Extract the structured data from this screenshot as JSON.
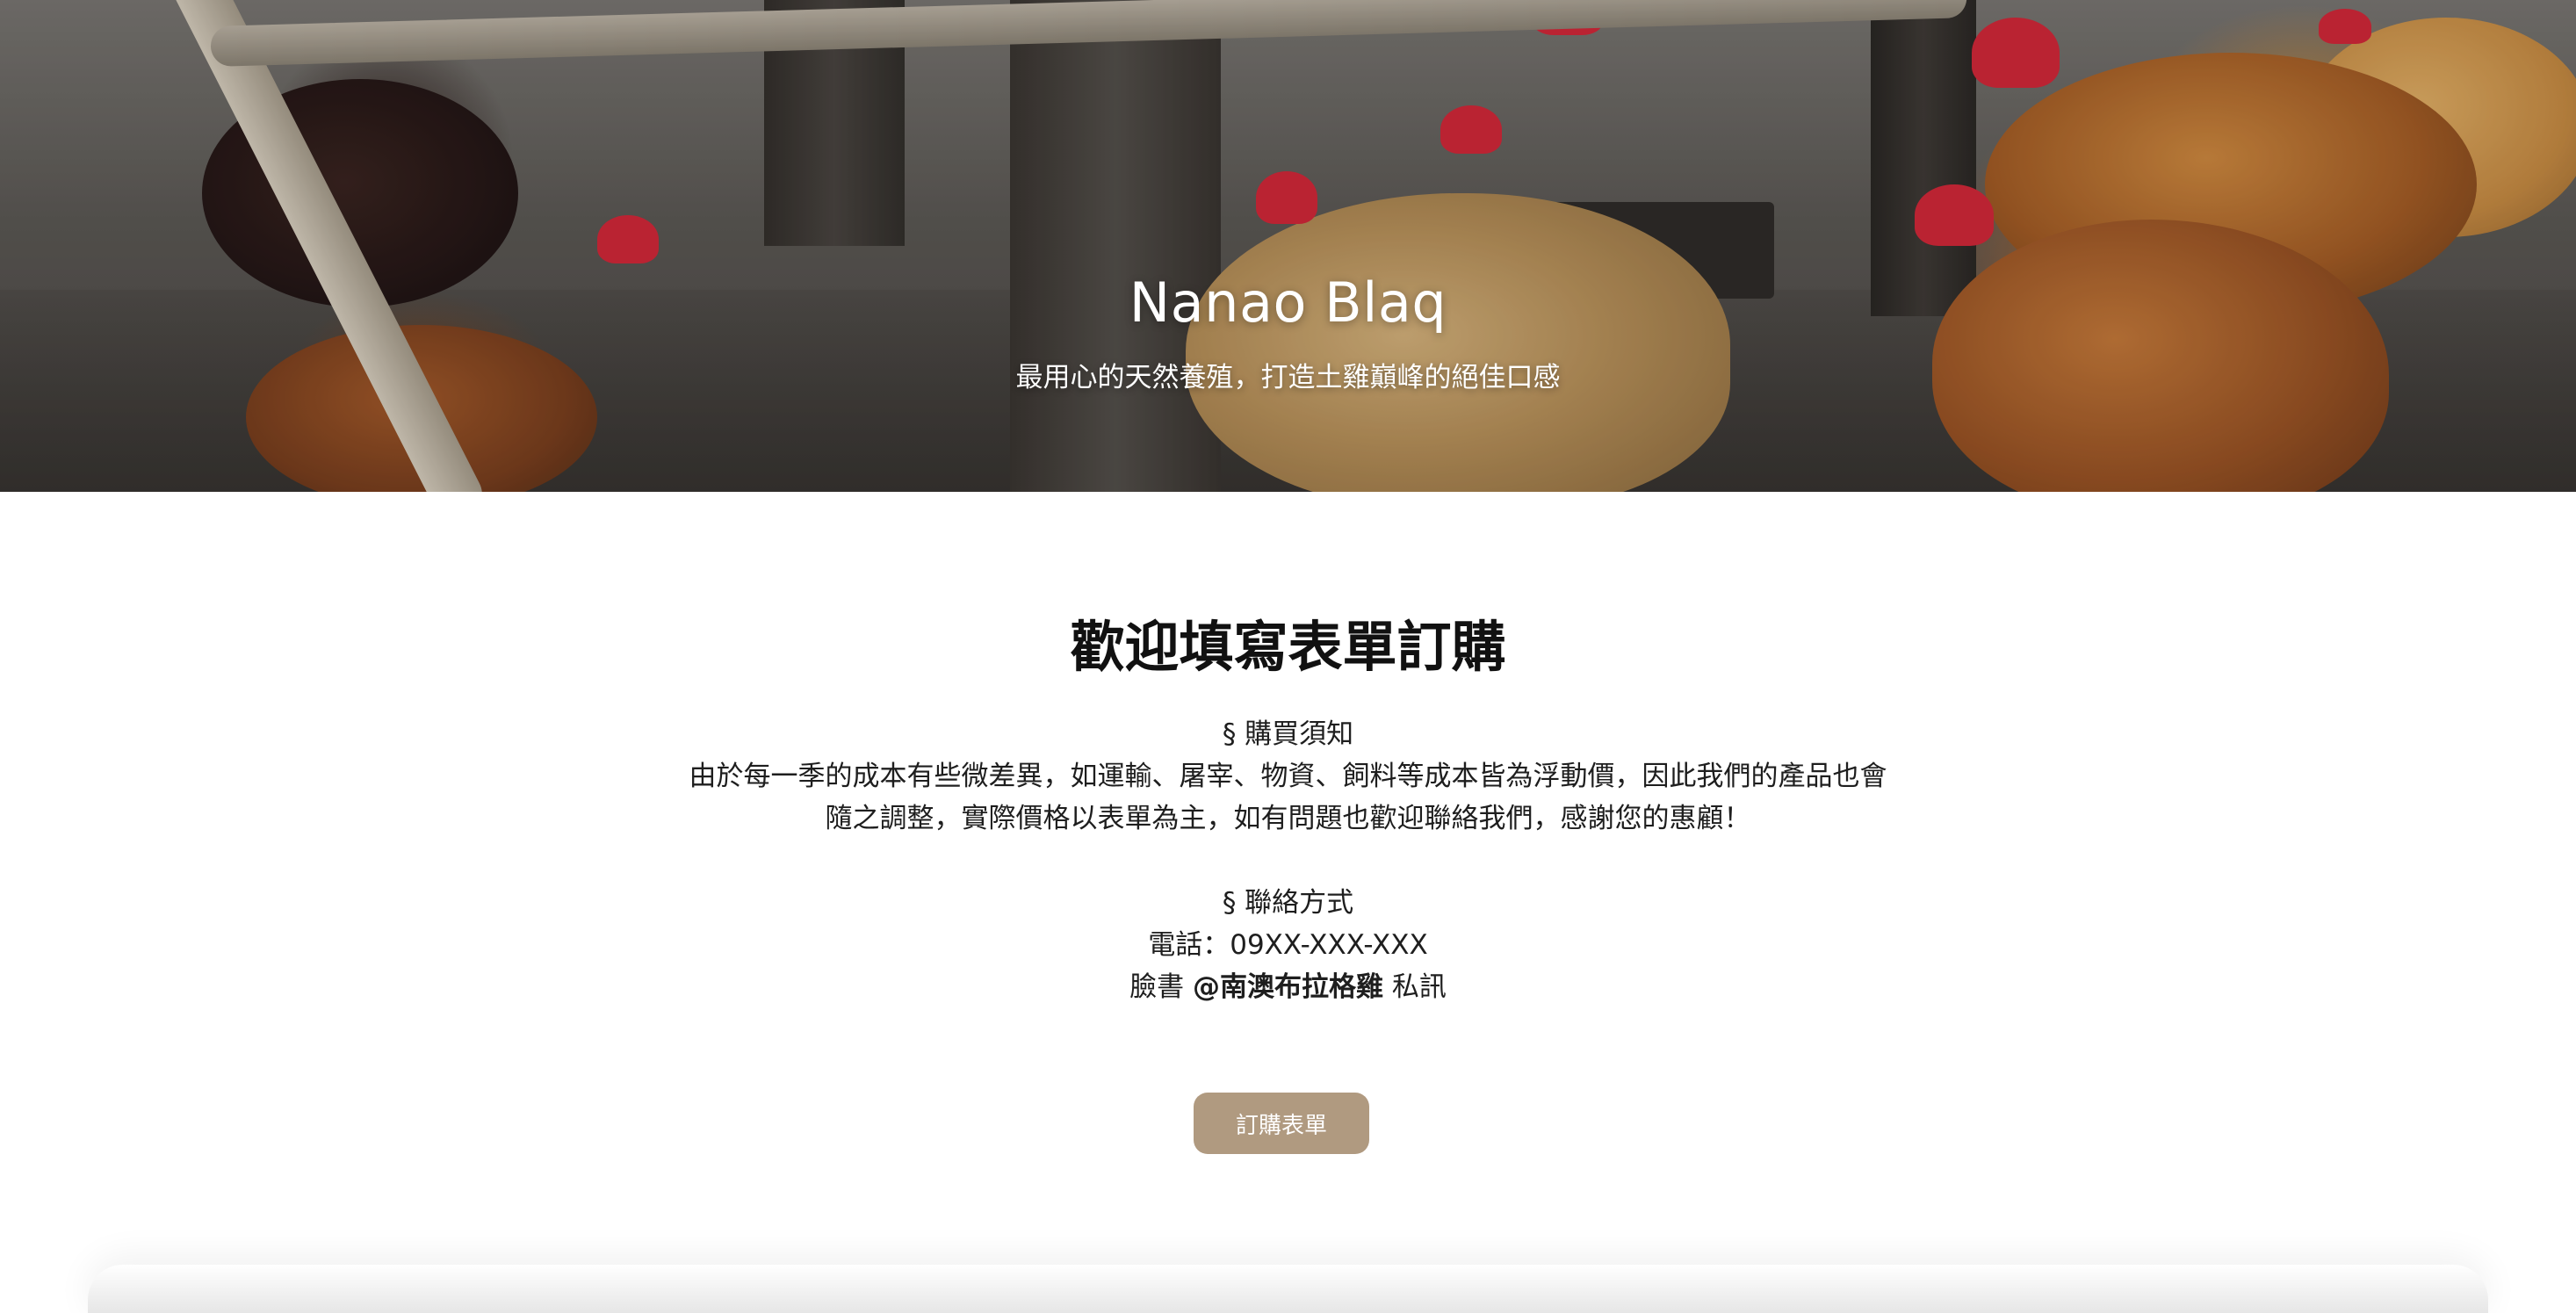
{
  "hero": {
    "title": "Nanao Blaq",
    "subtitle": "最用心的天然養殖，打造土雞巔峰的絕佳口感"
  },
  "main": {
    "heading": "歡迎填寫表單訂購",
    "purchase_notice_title": "§ 購買須知",
    "purchase_notice_line1": "由於每一季的成本有些微差異，如運輸、屠宰、物資、飼料等成本皆為浮動價，因此我們的產品也會",
    "purchase_notice_line2": "隨之調整，實際價格以表單為主，如有問題也歡迎聯絡我們，感謝您的惠顧！",
    "contact_title": "§ 聯絡方式",
    "phone": "電話：09XX-XXX-XXX",
    "facebook_prefix": "臉書",
    "facebook_handle": "@南澳布拉格雞",
    "facebook_suffix": "私訊",
    "order_button_label": "訂購表單"
  },
  "colors": {
    "button_bg": "#b09a80",
    "text": "#1e1e1e",
    "heading": "#111111"
  }
}
